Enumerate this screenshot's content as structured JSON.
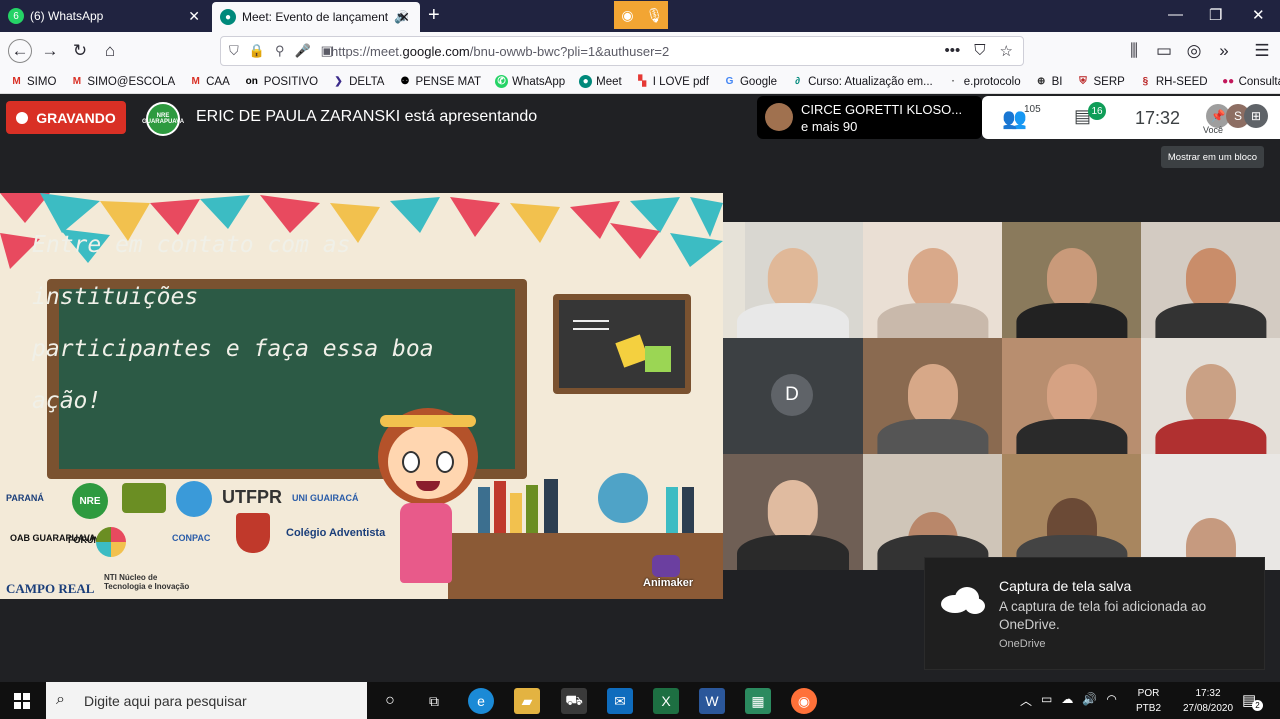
{
  "browser": {
    "tabs": [
      {
        "title": "(6) WhatsApp"
      },
      {
        "title": "Meet: Evento de lançament"
      }
    ],
    "url_pre": "https://meet.",
    "url_domain": "google.com",
    "url_post": "/bnu-owwb-bwc?pli=1&authuser=2",
    "bookmarks": [
      "SIMO",
      "SIMO@ESCOLA",
      "CAA",
      "POSITIVO",
      "DELTA",
      "PENSE MAT",
      "WhatsApp",
      "Meet",
      "I LOVE pdf",
      "Google",
      "Curso: Atualização em...",
      "e.protocolo",
      "BI",
      "SERP",
      "RH-SEED",
      "Consulta Esc."
    ]
  },
  "meet": {
    "recording_label": "GRAVANDO",
    "nre_logo_text": "NRE GUARAPUAVA",
    "presenter_text": "ERIC DE PAULA ZARANSKI está apresentando",
    "participant_name": "CIRCE GORETTI KLOSO...",
    "participant_more": "e mais 90",
    "people_count": "105",
    "chat_count": "16",
    "time": "17:32",
    "you_label": "Você",
    "avatar_letter": "S",
    "tooltip": "Mostrar em um bloco",
    "tile_d_letter": "D"
  },
  "slide": {
    "line1": "Entre em contato com as instituições",
    "line2": "participantes e faça essa boa ação!",
    "brand": "Animaker",
    "logos": [
      "PARANÁ",
      "NRE",
      "UTFPR",
      "UNI GUAIRACÁ",
      "OAB GUARAPUAVA",
      "FORUM CT&I",
      "CONPAC",
      "Colégio Adventista",
      "CAMPO REAL",
      "NTI Núcleo de Tecnologia e Inovação"
    ]
  },
  "toast": {
    "title": "Captura de tela salva",
    "body": "A captura de tela foi adicionada ao OneDrive.",
    "source": "OneDrive"
  },
  "taskbar": {
    "search_placeholder": "Digite aqui para pesquisar",
    "lang1": "POR",
    "lang2": "PTB2",
    "time": "17:32",
    "date": "27/08/2020",
    "notif_count": "2"
  },
  "colors": {
    "recording": "#d93025",
    "chalkboard": "#2c5a45",
    "tab_bar": "#202340"
  }
}
